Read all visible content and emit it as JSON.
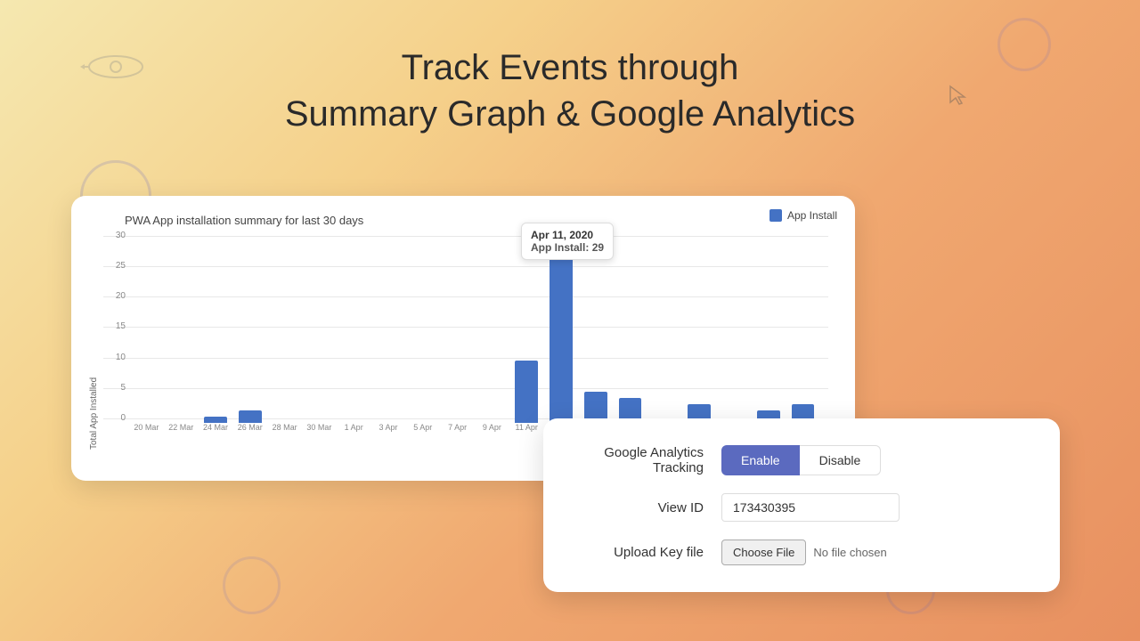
{
  "page": {
    "title_line1": "Track Events through",
    "title_line2": "Summary Graph & Google Analytics",
    "bg_color": "#f5d890"
  },
  "chart": {
    "title": "PWA App installation summary for last 30 days",
    "y_axis_label": "Total App Installed",
    "legend_label": "App Install",
    "y_values": [
      "30",
      "25",
      "20",
      "15",
      "10",
      "5",
      "0"
    ],
    "x_labels": [
      "20 Mar",
      "22 Mar",
      "24 Mar",
      "26 Mar",
      "28 Mar",
      "30 Mar",
      "1 Apr",
      "3 Apr",
      "5 Apr",
      "7 Apr",
      "9 Apr",
      "11 Apr",
      "",
      "",
      "",
      "",
      ""
    ],
    "bars": [
      0,
      0,
      1,
      2,
      0,
      0,
      0,
      0,
      0,
      0,
      0,
      10,
      29,
      5,
      4,
      0,
      3,
      0,
      2,
      3
    ],
    "max_value": 30,
    "tooltip": {
      "date": "Apr 11, 2020",
      "label": "App Install:",
      "value": "29"
    }
  },
  "analytics": {
    "tracking_label": "Google Analytics Tracking",
    "enable_label": "Enable",
    "disable_label": "Disable",
    "view_id_label": "View ID",
    "view_id_value": "173430395",
    "upload_label": "Upload Key file",
    "choose_file_label": "Choose File",
    "no_file_text": "No file chosen"
  }
}
